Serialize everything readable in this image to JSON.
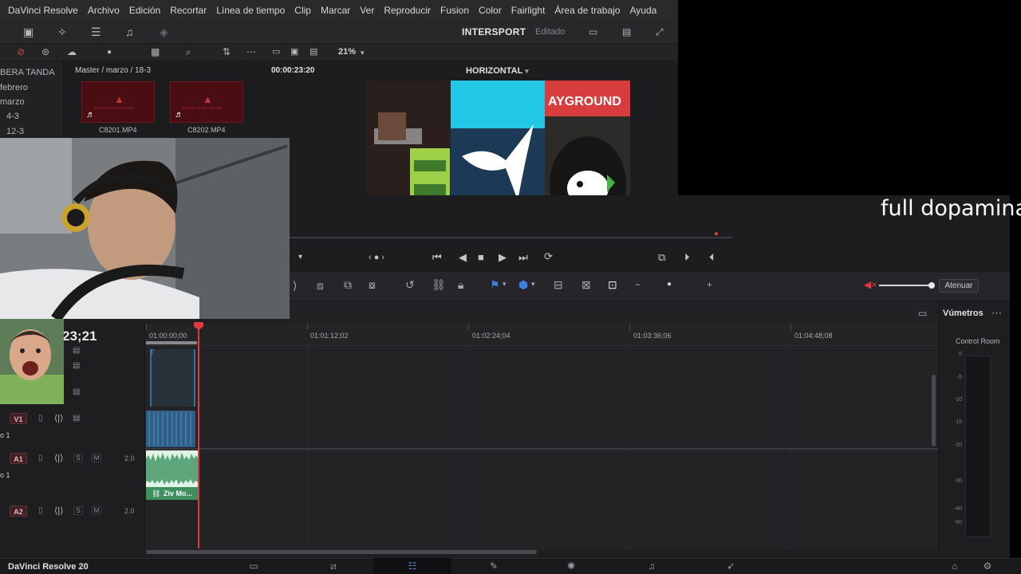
{
  "menu": [
    "DaVinci Resolve",
    "Archivo",
    "Edición",
    "Recortar",
    "Línea de tiempo",
    "Clip",
    "Marcar",
    "Ver",
    "Reproducir",
    "Fusion",
    "Color",
    "Fairlight",
    "Área de trabajo",
    "Ayuda"
  ],
  "project": {
    "title": "INTERSPORT",
    "status": "Editado"
  },
  "toolbar": {
    "zoom": "21%"
  },
  "media_pool": {
    "bins": [
      "BERA TANDA",
      "febrero",
      "marzo",
      "4-3",
      "12-3"
    ],
    "path": "Master / marzo / 18-3",
    "clips": [
      {
        "name": "C8201.MP4",
        "offline_text": "Archivo no encontrado"
      },
      {
        "name": "C8202.MP4",
        "offline_text": "Archivo no encontrado"
      }
    ]
  },
  "viewer": {
    "timecode": "00:00:23:20",
    "timeline_name": "HORIZONTAL",
    "sign_text": "AYGROUND"
  },
  "overlay_caption": "full dopamina",
  "edit_toolbar": {
    "atenuar": "Atenuar"
  },
  "timeline": {
    "current_tc": "23;21",
    "ruler": [
      "01:00:00;00",
      "01:01:12;02",
      "01:02:24;04",
      "01:03:36;06",
      "01:04:48;08"
    ],
    "tracks": {
      "v1": {
        "label": "V1",
        "name": "o 1"
      },
      "a1": {
        "label": "A1",
        "name": "o 1",
        "vol": "2.0",
        "clip": "Ziv Mo..."
      },
      "a2": {
        "label": "A2",
        "vol": "2.0"
      }
    },
    "solo": "S",
    "mute": "M"
  },
  "meters": {
    "title": "Vúmetros",
    "control_room": "Control Room",
    "scale": [
      "0",
      "-5",
      "-10",
      "-15",
      "-20",
      "-30",
      "-40",
      "-50"
    ]
  },
  "footer": {
    "app_version": "DaVinci Resolve 20"
  }
}
